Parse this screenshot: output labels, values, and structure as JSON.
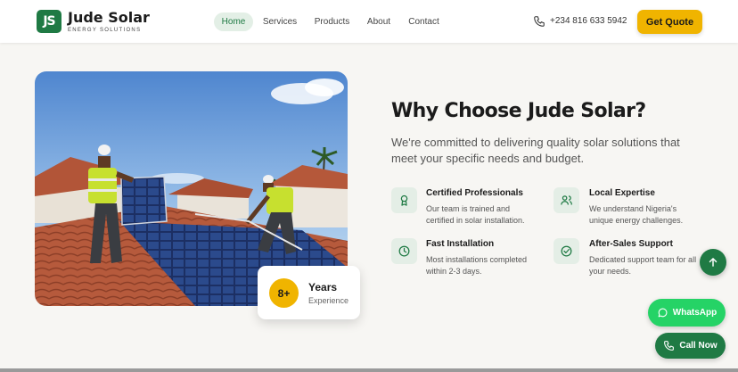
{
  "brand": {
    "mark": "JS",
    "name": "Jude Solar",
    "tagline": "ENERGY SOLUTIONS"
  },
  "nav": [
    {
      "label": "Home",
      "active": true
    },
    {
      "label": "Services",
      "active": false
    },
    {
      "label": "Products",
      "active": false
    },
    {
      "label": "About",
      "active": false
    },
    {
      "label": "Contact",
      "active": false
    }
  ],
  "header": {
    "phone": "+234 816 633 5942",
    "cta": "Get Quote"
  },
  "experience": {
    "badge": "8+",
    "title": "Years",
    "subtitle": "Experience"
  },
  "section": {
    "title": "Why Choose Jude Solar?",
    "subtitle": "We're committed to delivering quality solar solutions that meet your specific needs and budget."
  },
  "features": [
    {
      "icon": "award-icon",
      "title": "Certified Professionals",
      "desc": "Our team is trained and certified in solar installation."
    },
    {
      "icon": "users-icon",
      "title": "Local Expertise",
      "desc": "We understand Nigeria's unique energy challenges."
    },
    {
      "icon": "clock-icon",
      "title": "Fast Installation",
      "desc": "Most installations completed within 2-3 days."
    },
    {
      "icon": "check-circle-icon",
      "title": "After-Sales Support",
      "desc": "Dedicated support team for all your needs."
    }
  ],
  "floating": {
    "whatsapp": "WhatsApp",
    "call": "Call Now"
  },
  "colors": {
    "brand_green": "#1f7a44",
    "accent_yellow": "#f0b400",
    "whatsapp_green": "#25d366"
  }
}
